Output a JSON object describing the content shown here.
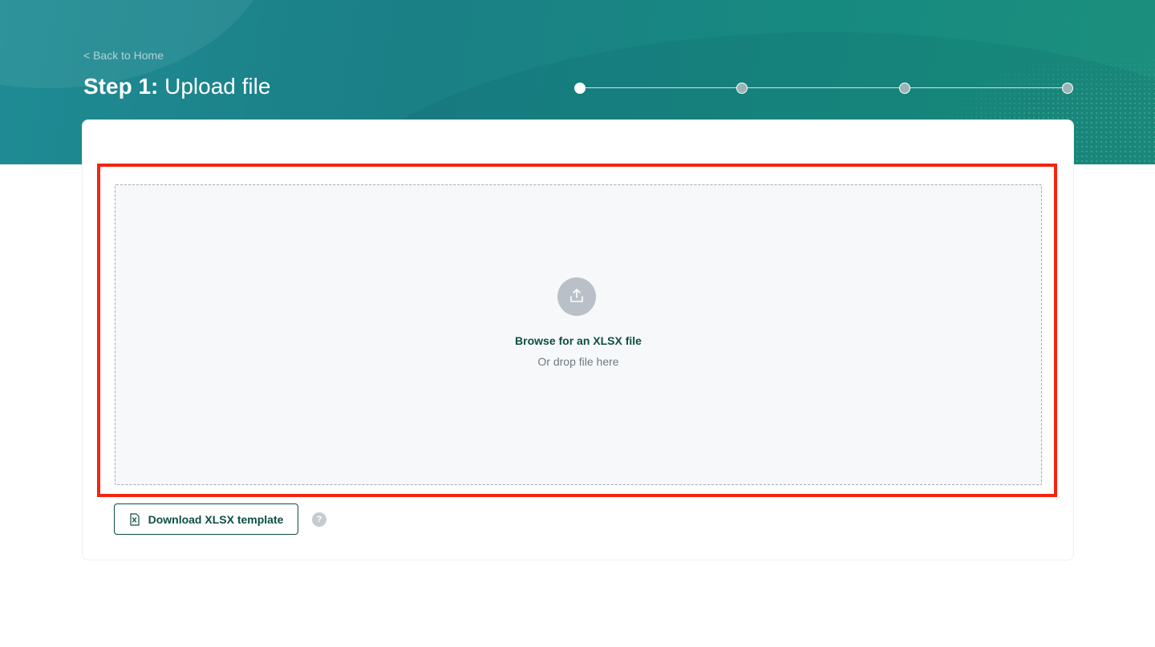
{
  "header": {
    "back_link": "< Back to Home",
    "title_step": "Step 1:",
    "title_text": " Upload file"
  },
  "stepper": {
    "total_steps": 4,
    "current_step": 1
  },
  "dropzone": {
    "browse_label": "Browse for an XLSX file",
    "drop_hint": "Or drop file here",
    "icon": "upload-icon"
  },
  "actions": {
    "download_template_label": "Download XLSX template",
    "download_icon": "excel-file-icon",
    "help_icon_glyph": "?"
  },
  "colors": {
    "header_teal": "#1b8a8a",
    "brand_dark_green": "#0d4e43",
    "highlight_red": "#f4250f"
  }
}
